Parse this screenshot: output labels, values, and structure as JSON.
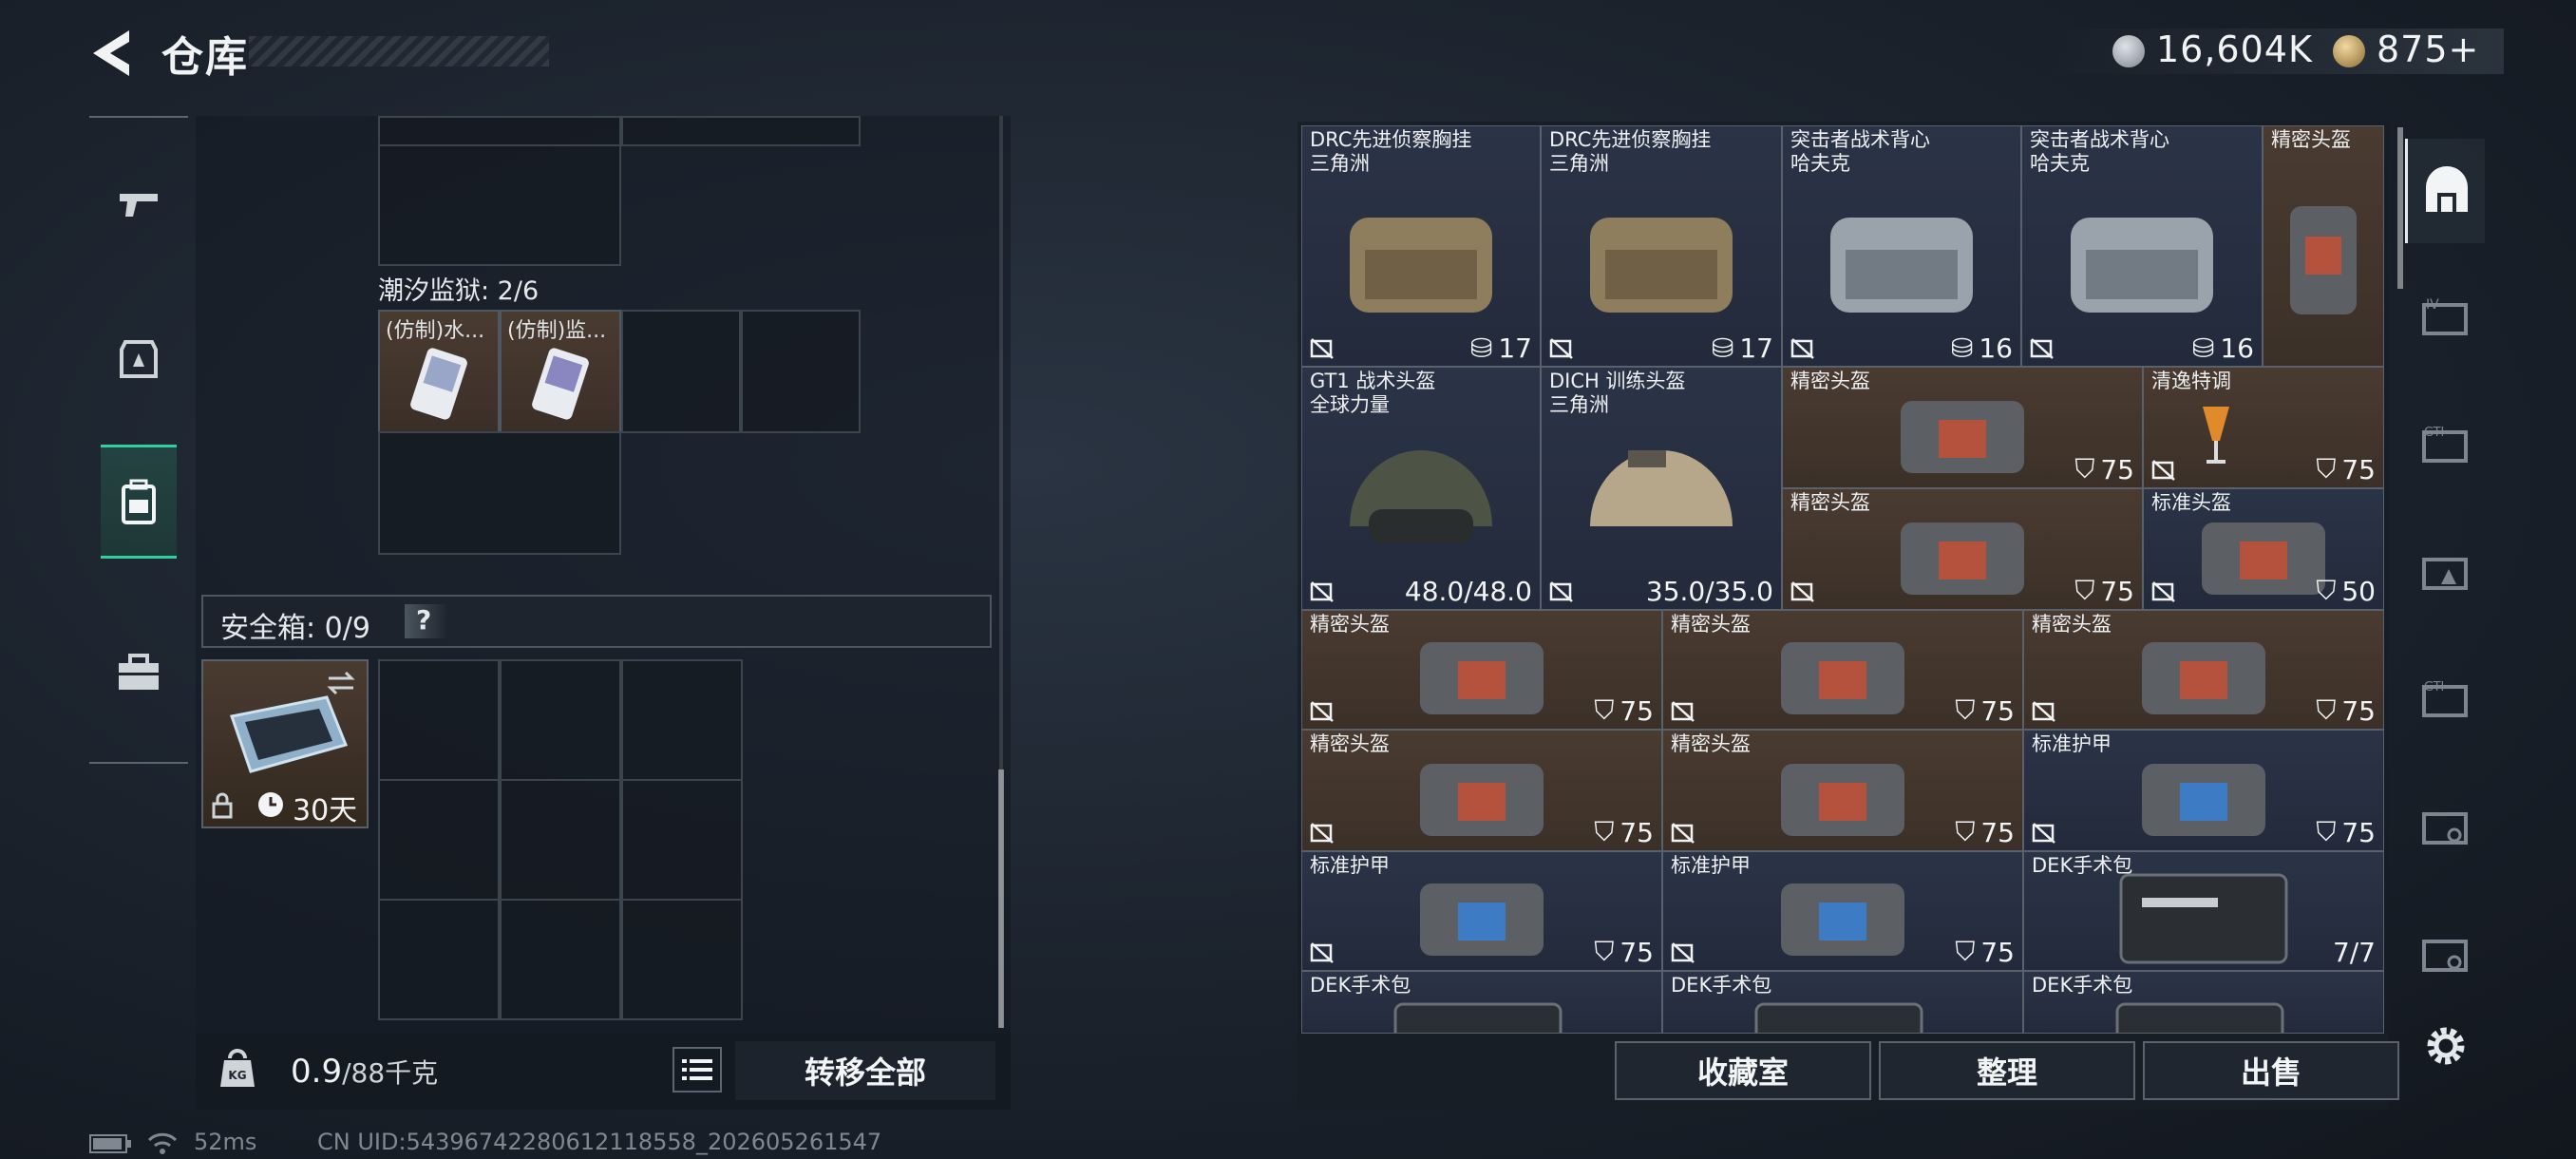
{
  "header": {
    "title": "仓库",
    "currency_silver": "16,604K",
    "currency_gold": "875",
    "add_symbol": "+"
  },
  "backpack": {
    "section_prison_label": "潮汐监狱: 2/6",
    "prison_items": [
      "(仿制)水...",
      "(仿制)监..."
    ],
    "safe_label": "安全箱: 0/9",
    "help": "?",
    "safe_days": "30天",
    "weight_current": "0.9",
    "weight_max": "/88千克",
    "transfer_all": "转移全部"
  },
  "warehouse": {
    "row1": [
      {
        "name": "DRC先进侦察胸挂",
        "sub": "三角洲",
        "value": "17"
      },
      {
        "name": "DRC先进侦察胸挂",
        "sub": "三角洲",
        "value": "17"
      },
      {
        "name": "突击者战术背心",
        "sub": "哈夫克",
        "value": "16"
      },
      {
        "name": "突击者战术背心",
        "sub": "哈夫克",
        "value": "16"
      },
      {
        "name": "精密头盔",
        "sub": "",
        "value": ""
      }
    ],
    "helmet1": {
      "name": "GT1 战术头盔",
      "sub": "全球力量",
      "value": "48.0/48.0"
    },
    "helmet2": {
      "name": "DICH 训练头盔",
      "sub": "三角洲",
      "value": "35.0/35.0"
    },
    "small_items": [
      {
        "name": "精密头盔",
        "value": "75"
      },
      {
        "name": "清逸特调",
        "value": "75"
      },
      {
        "name": "精密头盔",
        "value": "75"
      },
      {
        "name": "标准头盔",
        "value": "50"
      }
    ],
    "row4": [
      {
        "name": "精密头盔",
        "value": "75"
      },
      {
        "name": "精密头盔",
        "value": "75"
      },
      {
        "name": "精密头盔",
        "value": "75"
      }
    ],
    "row5": [
      {
        "name": "精密头盔",
        "value": "75"
      },
      {
        "name": "精密头盔",
        "value": "75"
      },
      {
        "name": "标准护甲",
        "value": "75"
      }
    ],
    "row6": [
      {
        "name": "标准护甲",
        "value": "75"
      },
      {
        "name": "标准护甲",
        "value": "75"
      },
      {
        "name": "DEK手术包",
        "value": "7/7"
      }
    ],
    "row7": [
      {
        "name": "DEK手术包"
      },
      {
        "name": "DEK手术包"
      },
      {
        "name": "DEK手术包"
      }
    ],
    "buttons": {
      "collection": "收藏室",
      "sort": "整理",
      "sell": "出售"
    }
  },
  "status_bar": {
    "ping": "52ms",
    "uid": "CN UID:543967422806121185​58_202605261547"
  },
  "colors": {
    "accent_green": "#2fd0a0",
    "slot_blue": "#2b3347",
    "slot_brown": "#4a3b31"
  }
}
